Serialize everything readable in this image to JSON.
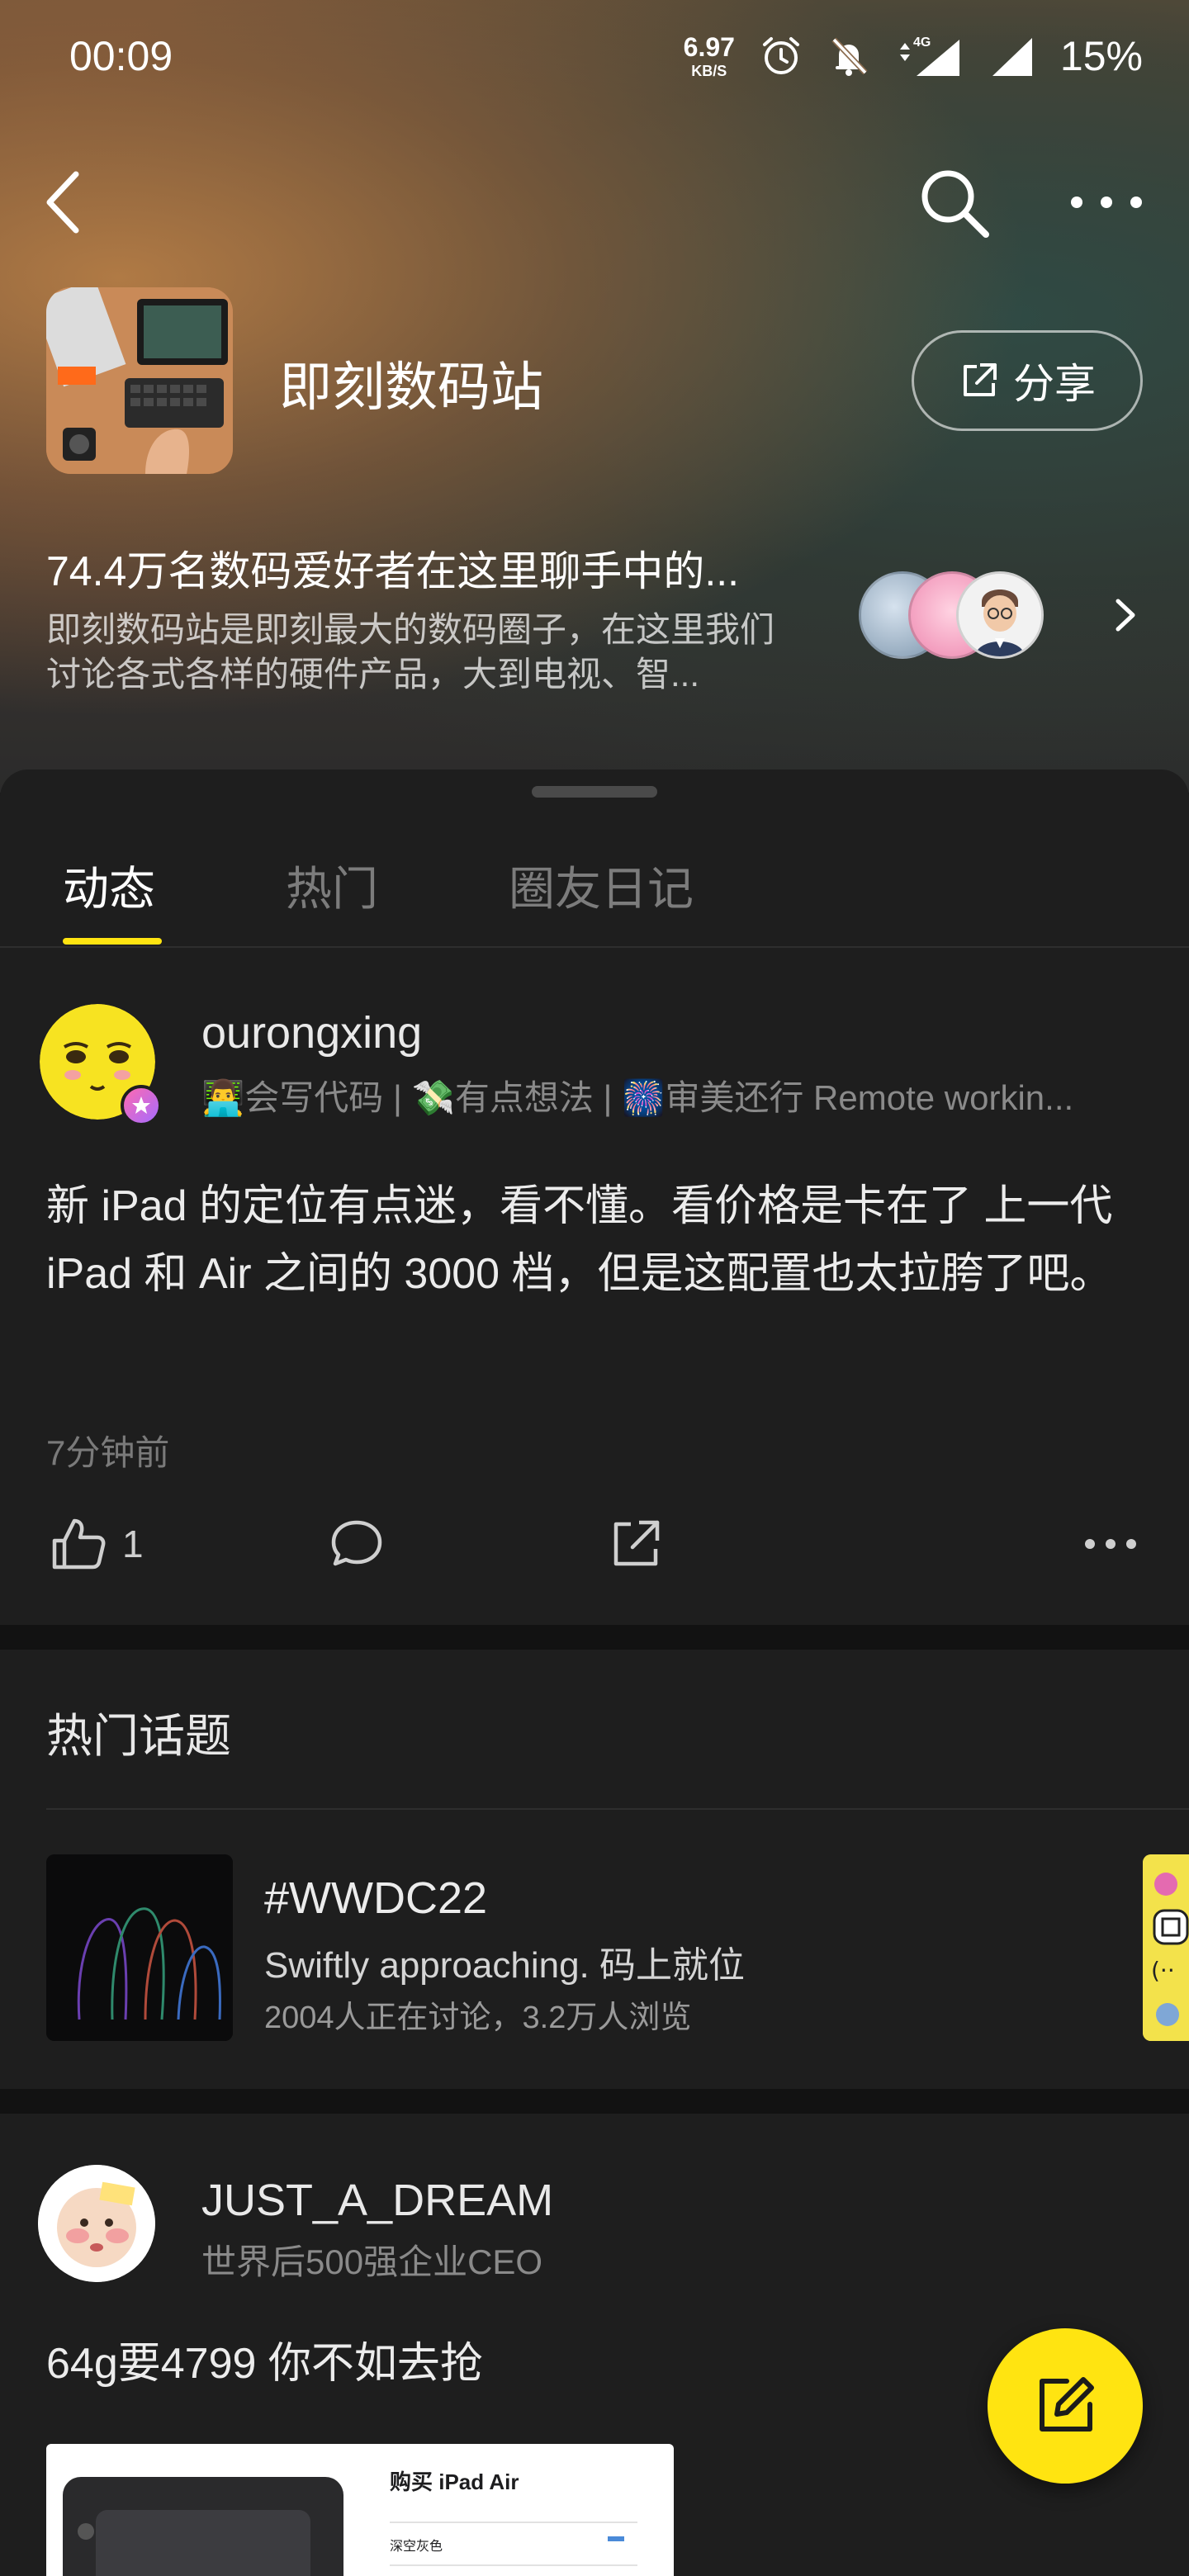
{
  "status_bar": {
    "time": "00:09",
    "net_speed_value": "6.97",
    "net_speed_unit": "KB/S",
    "network_type": "4G",
    "battery": "15%"
  },
  "circle": {
    "title": "即刻数码站",
    "share_label": "分享",
    "headline": "74.4万名数码爱好者在这里聊手中的...",
    "description": "即刻数码站是即刻最大的数码圈子，在这里我们讨论各式各样的硬件产品，大到电视、智..."
  },
  "tabs": [
    {
      "label": "动态",
      "active": true
    },
    {
      "label": "热门",
      "active": false
    },
    {
      "label": "圈友日记",
      "active": false
    }
  ],
  "post1": {
    "username": "ourongxing",
    "bio": "👨‍💻会写代码 | 💸有点想法 | 🎆审美还行 Remote workin...",
    "body": "新 iPad 的定位有点迷，看不懂。看价格是卡在了 上一代 iPad 和 Air 之间的 3000 档，但是这配置也太拉胯了吧。",
    "time": "7分钟前",
    "like_count": "1"
  },
  "hot_topics": {
    "section_title": "热门话题",
    "topic": {
      "name": "#WWDC22",
      "subtitle": "Swiftly approaching. 码上就位",
      "meta": "2004人正在讨论，3.2万人浏览"
    }
  },
  "post2": {
    "username": "JUST_A_DREAM",
    "bio": "世界后500强企业CEO",
    "body": "64g要4799 你不如去抢",
    "image_title": "购买 iPad Air",
    "image_option": "深空灰色"
  },
  "colors": {
    "accent": "#ffe411",
    "background": "#1e1e1e"
  }
}
